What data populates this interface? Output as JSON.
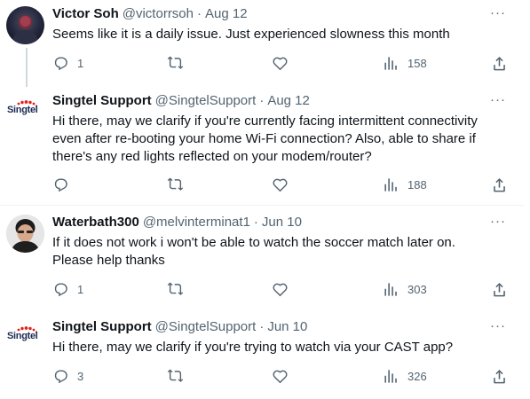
{
  "tweets": [
    {
      "name": "Victor Soh",
      "handle": "@victorrsoh",
      "dot": "·",
      "date": "Aug 12",
      "text": "Seems like it is a daily issue. Just experienced slowness this month",
      "replies": "1",
      "retweets": "",
      "likes": "",
      "views": "158",
      "avatar": "dark-portrait"
    },
    {
      "name": "Singtel Support",
      "handle": "@SingtelSupport",
      "dot": "·",
      "date": "Aug 12",
      "text": "Hi there, may we clarify if you're currently facing intermittent connectivity\neven after re-booting your home Wi-Fi connection? Also, able to share if\nthere's any red lights reflected on your modem/router?",
      "replies": "",
      "retweets": "",
      "likes": "",
      "views": "188",
      "avatar": "singtel-logo",
      "logo_text": "Singtel"
    },
    {
      "name": "Waterbath300",
      "handle": "@melvinterminat1",
      "dot": "·",
      "date": "Jun 10",
      "text": "If it does not work i won't be able to watch the soccer match later on.\nPlease help thanks",
      "replies": "1",
      "retweets": "",
      "likes": "",
      "views": "303",
      "avatar": "person-photo"
    },
    {
      "name": "Singtel Support",
      "handle": "@SingtelSupport",
      "dot": "·",
      "date": "Jun 10",
      "text": "Hi there, may we clarify if you're trying to watch via your CAST app?",
      "replies": "3",
      "retweets": "",
      "likes": "",
      "views": "326",
      "avatar": "singtel-logo",
      "logo_text": "Singtel"
    }
  ],
  "more_label": "···",
  "colors": {
    "text": "#0f1419",
    "secondary": "#536471",
    "border": "#eff3f4",
    "thread": "#cfd9de"
  }
}
